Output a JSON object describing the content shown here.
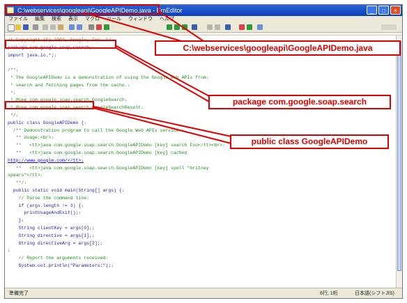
{
  "window": {
    "title": "C:\\webservices\\googleapi\\GoogleAPIDemo.java - EmEditor",
    "controls": [
      "_",
      "□",
      "×"
    ]
  },
  "menubar": [
    "ファイル",
    "編集",
    "検索",
    "表示",
    "マクロ",
    "ツール",
    "ウィンドウ",
    "ヘルプ"
  ],
  "code": {
    "lines": [
      {
        "t": "/* Copyright (C) 2002, Google, Inc. */↓",
        "cls": "c-com"
      },
      {
        "t": "package com.google.soap.search;↓",
        "cls": "c-kw"
      },
      {
        "t": "import java.io.*;↓",
        "cls": "c-kw"
      },
      {
        "t": "",
        "cls": ""
      },
      {
        "t": "/**↓",
        "cls": "c-com"
      },
      {
        "t": " * The GoogleAPIDemo is a demonstration of using the Google Web APIs from↓",
        "cls": "c-com"
      },
      {
        "t": " * search and fetching pages from the cache.↓",
        "cls": "c-com"
      },
      {
        "t": " *↓",
        "cls": "c-com"
      },
      {
        "t": " * @see com.google.soap.search.GoogleSearch↓",
        "cls": "c-com"
      },
      {
        "t": " * @see com.google.soap.search.GoogleSearchResult↓",
        "cls": "c-com"
      },
      {
        "t": " */↓",
        "cls": "c-com"
      },
      {
        "t": "public class GoogleAPIDemo {↓",
        "cls": "c-kw"
      },
      {
        "t": "  /** Demonstration program to call the Google Web APIs service.↓",
        "cls": "c-com"
      },
      {
        "t": "   ** Usage:<br>↓",
        "cls": "c-com"
      },
      {
        "t": "   **   <tt>java com.google.soap.search.GoogleAPIDemo [key] search Foo</tt><br>↓",
        "cls": "c-com"
      },
      {
        "t": "   **   <tt>java com.google.soap.search.GoogleAPIDemo [key] cached",
        "cls": "c-com"
      },
      {
        "t": "http://www.google.com/</tt>↓",
        "cls": "c-link"
      },
      {
        "t": "   **   <tt>java com.google.soap.search.GoogleAPIDemo [key] spell \"britney",
        "cls": "c-com"
      },
      {
        "t": "spears\"</tt>↓",
        "cls": "c-com"
      },
      {
        "t": "   **/↓",
        "cls": "c-com"
      },
      {
        "t": "  public static void main(String[] args) {↓",
        "cls": "c-code"
      },
      {
        "t": "    // Parse the command line↓",
        "cls": "c-com"
      },
      {
        "t": "    if (args.length != 3) {↓",
        "cls": "c-code"
      },
      {
        "t": "      printUsageAndExit();↓",
        "cls": "c-code"
      },
      {
        "t": "    }↓",
        "cls": "c-code"
      },
      {
        "t": "    String clientKey = args[0];↓",
        "cls": "c-code"
      },
      {
        "t": "    String directive = args[1];↓",
        "cls": "c-code"
      },
      {
        "t": "    String directiveArg = args[2];↓",
        "cls": "c-code"
      },
      {
        "t": "↓",
        "cls": "c-code"
      },
      {
        "t": "    // Report the arguments received↓",
        "cls": "c-com"
      },
      {
        "t": "    System.out.println(\"Parameters:\");↓",
        "cls": "c-code"
      }
    ]
  },
  "statusbar": {
    "left": "準備完了",
    "pos": "6行, 1桁",
    "enc": "日本語(シフトJIS)"
  },
  "callouts": {
    "file": "C:\\webservices\\googleapi\\GoogleAPIDemo.java",
    "package": "package com.google.soap.search",
    "class": "public class GoogleAPIDemo"
  },
  "colors": {
    "annotation": "#e00000",
    "titlebar": "#0a3fb8",
    "comment": "#1f8a1f",
    "keyword": "#1a1aa8"
  }
}
